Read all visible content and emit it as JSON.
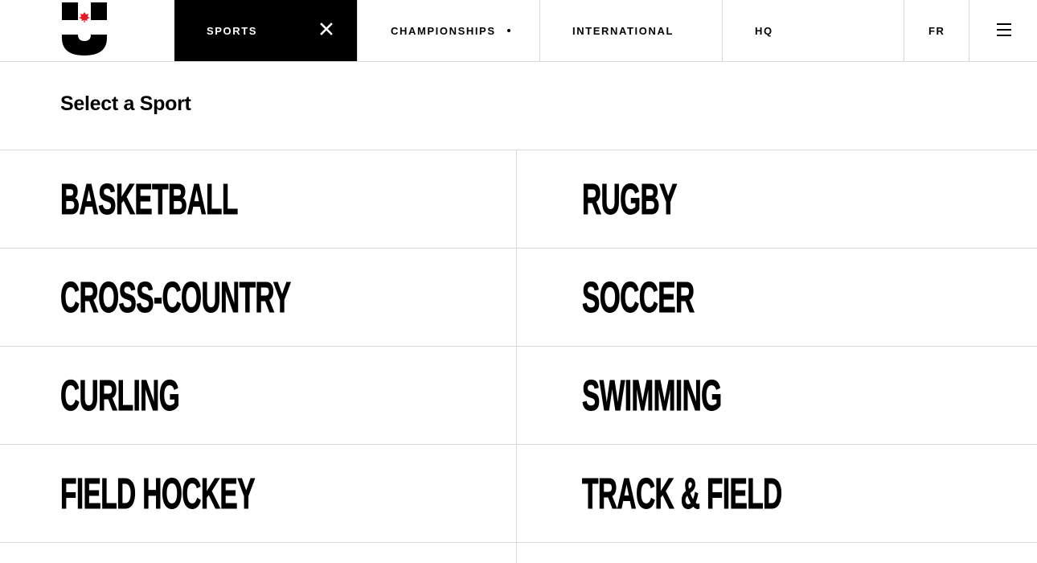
{
  "brand": {
    "logo_text": "SPORTS",
    "leaf_color": "#e31b23"
  },
  "nav": {
    "sports": "SPORTS",
    "championships": "CHAMPIONSHIPS",
    "international": "INTERNATIONAL",
    "hq": "HQ",
    "fr": "FR"
  },
  "page": {
    "title": "Select a Sport"
  },
  "sports": [
    {
      "left": "BASKETBALL",
      "right": "RUGBY"
    },
    {
      "left": "CROSS-COUNTRY",
      "right": "SOCCER"
    },
    {
      "left": "CURLING",
      "right": "SWIMMING"
    },
    {
      "left": "FIELD HOCKEY",
      "right": "TRACK & FIELD"
    }
  ],
  "icons": {
    "close": "close-icon",
    "menu": "hamburger-menu-icon",
    "dropdown_dot": "dropdown-dot-icon"
  },
  "colors": {
    "active_tab_bg": "#000000",
    "active_tab_text": "#ffffff",
    "divider": "#d8d8d8"
  }
}
